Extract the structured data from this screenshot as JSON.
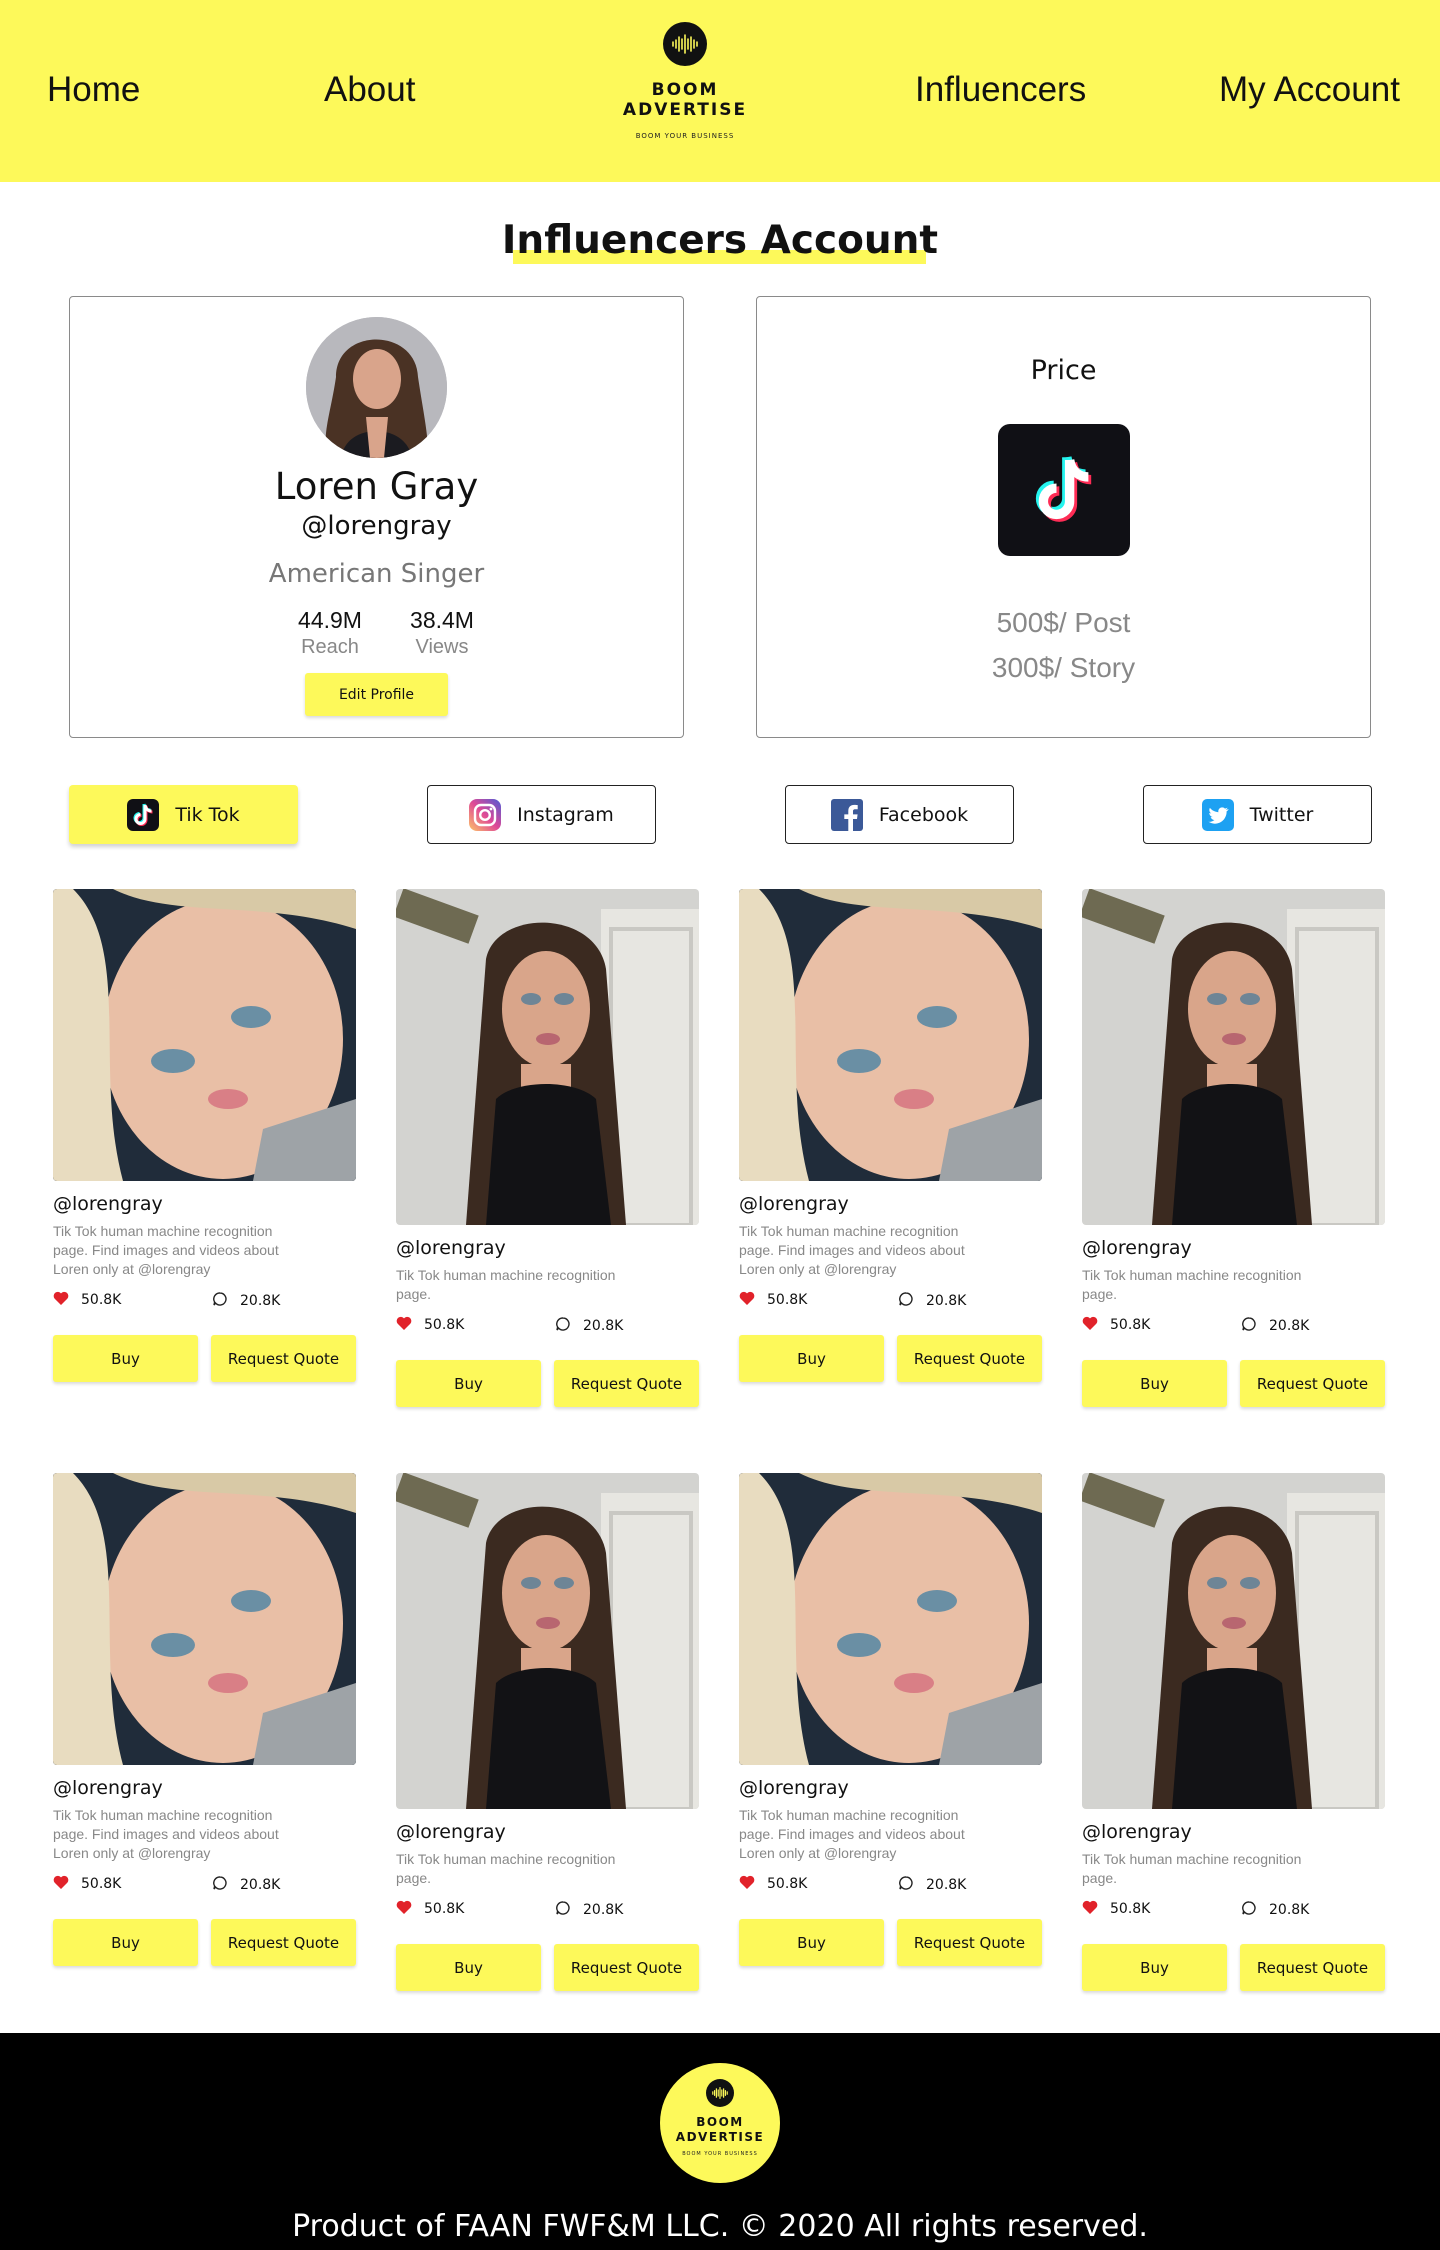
{
  "colors": {
    "accent": "#fdf95a",
    "footer_bg": "#000000",
    "muted_text": "#888888"
  },
  "nav": {
    "home": "Home",
    "about": "About",
    "influencers": "Influencers",
    "account": "My Account"
  },
  "logo": {
    "line1": "BOOM",
    "line2": "ADVERTISE",
    "tagline": "BOOM YOUR BUSINESS",
    "icon": "soundwave-icon"
  },
  "page": {
    "title": "Influencers Account"
  },
  "profile": {
    "name": "Loren Gray",
    "handle": "@lorengray",
    "role": "American Singer",
    "reach_value": "44.9M",
    "reach_label": "Reach",
    "views_value": "38.4M",
    "views_label": "Views",
    "edit_label": "Edit Profile"
  },
  "price": {
    "title": "Price",
    "post": "500$/ Post",
    "story": "300$/ Story",
    "icon": "tiktok-icon"
  },
  "tabs": [
    {
      "label": "Tik Tok",
      "icon": "tiktok-icon",
      "active": true
    },
    {
      "label": "Instagram",
      "icon": "instagram-icon",
      "active": false
    },
    {
      "label": "Facebook",
      "icon": "facebook-icon",
      "active": false
    },
    {
      "label": "Twitter",
      "icon": "twitter-icon",
      "active": false
    }
  ],
  "posts": [
    {
      "handle": "@lorengray",
      "desc": "Tik Tok human machine recognition page. Find images and videos about Loren only at @lorengray",
      "likes": "50.8K",
      "comments": "20.8K",
      "buy": "Buy",
      "quote": "Request Quote"
    },
    {
      "handle": "@lorengray",
      "desc": "Tik Tok human machine recognition page.",
      "likes": "50.8K",
      "comments": "20.8K",
      "buy": "Buy",
      "quote": "Request Quote"
    },
    {
      "handle": "@lorengray",
      "desc": "Tik Tok human machine recognition page. Find images and videos about Loren only at @lorengray",
      "likes": "50.8K",
      "comments": "20.8K",
      "buy": "Buy",
      "quote": "Request Quote"
    },
    {
      "handle": "@lorengray",
      "desc": "Tik Tok human machine recognition page.",
      "likes": "50.8K",
      "comments": "20.8K",
      "buy": "Buy",
      "quote": "Request Quote"
    },
    {
      "handle": "@lorengray",
      "desc": "Tik Tok human machine recognition page. Find images and videos about Loren only at @lorengray",
      "likes": "50.8K",
      "comments": "20.8K",
      "buy": "Buy",
      "quote": "Request Quote"
    },
    {
      "handle": "@lorengray",
      "desc": "Tik Tok human machine recognition page.",
      "likes": "50.8K",
      "comments": "20.8K",
      "buy": "Buy",
      "quote": "Request Quote"
    },
    {
      "handle": "@lorengray",
      "desc": "Tik Tok human machine recognition page. Find images and videos about Loren only at @lorengray",
      "likes": "50.8K",
      "comments": "20.8K",
      "buy": "Buy",
      "quote": "Request Quote"
    },
    {
      "handle": "@lorengray",
      "desc": "Tik Tok human machine recognition page.",
      "likes": "50.8K",
      "comments": "20.8K",
      "buy": "Buy",
      "quote": "Request Quote"
    }
  ],
  "footer": {
    "logo_line1": "BOOM",
    "logo_line2": "ADVERTISE",
    "logo_tagline": "BOOM YOUR BUSINESS",
    "text": "Product of FAAN FWF&M LLC.  © 2020 All rights reserved."
  }
}
